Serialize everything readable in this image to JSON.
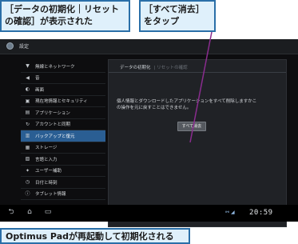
{
  "callouts": {
    "left": "［データの初期化｜リセットの確認］が表示された",
    "right": "［すべて消去］をタップ",
    "bottom": "Optimus Padが再起動して初期化される"
  },
  "titlebar": {
    "title": "設定"
  },
  "sidebar": {
    "items": [
      {
        "label": "無線とネットワーク",
        "icon": "wifi-icon"
      },
      {
        "label": "音",
        "icon": "speaker-icon"
      },
      {
        "label": "画面",
        "icon": "display-icon"
      },
      {
        "label": "現在地情報とセキュリティ",
        "icon": "lock-icon"
      },
      {
        "label": "アプリケーション",
        "icon": "apps-icon"
      },
      {
        "label": "アカウントと同期",
        "icon": "sync-icon"
      },
      {
        "label": "バックアップと復元",
        "icon": "backup-icon"
      },
      {
        "label": "ストレージ",
        "icon": "storage-icon"
      },
      {
        "label": "言語と入力",
        "icon": "language-icon"
      },
      {
        "label": "ユーザー補助",
        "icon": "accessibility-icon"
      },
      {
        "label": "日付と時刻",
        "icon": "clock-icon"
      },
      {
        "label": "タブレット情報",
        "icon": "info-icon"
      }
    ],
    "selected_index": 6
  },
  "content": {
    "header": "データの初期化",
    "header_sub": "リセットの確認",
    "description": "個人情報とダウンロードしたアプリケーションをすべて削除しますかこの操作を元に戻すことはできません。",
    "erase_button": "すべて消去"
  },
  "navbar": {
    "clock": "20:59"
  }
}
